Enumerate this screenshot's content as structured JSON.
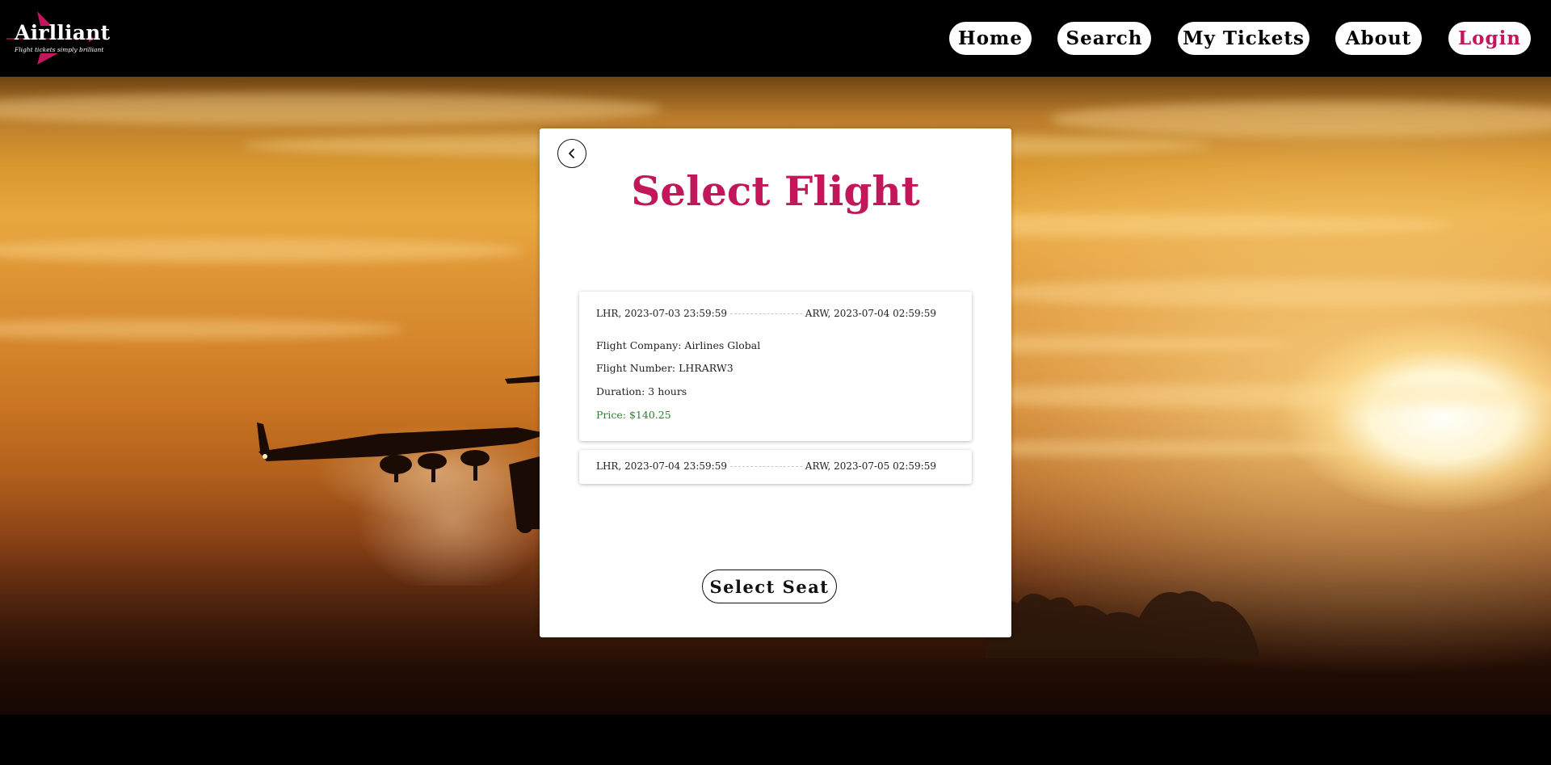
{
  "header": {
    "logo": {
      "title": "Airlliant",
      "tagline": "Flight tickets simply brilliant"
    },
    "nav": [
      {
        "label": "Home"
      },
      {
        "label": "Search"
      },
      {
        "label": "My Tickets"
      },
      {
        "label": "About"
      },
      {
        "label": "Login"
      }
    ]
  },
  "colors": {
    "accent": "#c2185b",
    "price": "#2e7d32",
    "header_bg": "#000000",
    "card_bg": "#ffffff"
  },
  "card": {
    "back_icon": "chevron-left-icon",
    "title": "Select Flight",
    "flights": [
      {
        "departure": "LHR, 2023-07-03 23:59:59",
        "arrival": "ARW, 2023-07-04 02:59:59",
        "expanded": true,
        "company": "Flight Company: Airlines Global",
        "number": "Flight Number: LHRARW3",
        "duration": "Duration: 3 hours",
        "price": "Price: $140.25"
      },
      {
        "departure": "LHR, 2023-07-04 23:59:59",
        "arrival": "ARW, 2023-07-05 02:59:59",
        "expanded": false
      }
    ],
    "select_seat_label": "Select Seat"
  }
}
